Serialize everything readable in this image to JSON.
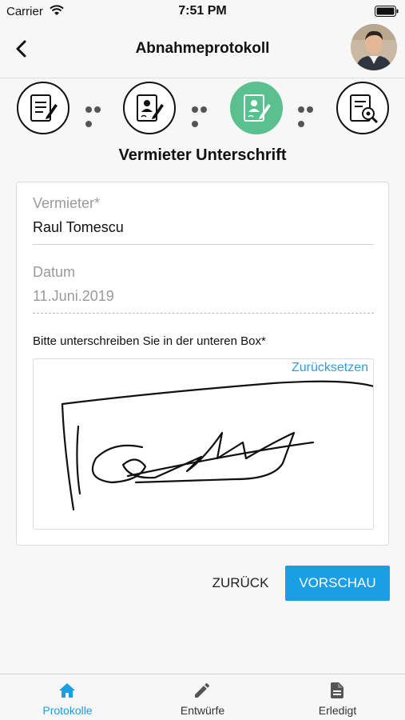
{
  "status_bar": {
    "carrier": "Carrier",
    "time": "7:51 PM"
  },
  "header": {
    "title": "Abnahmeprotokoll"
  },
  "steps": [
    {
      "icon": "document-edit-icon",
      "active": false
    },
    {
      "icon": "tenant-sign-icon",
      "active": false
    },
    {
      "icon": "landlord-sign-icon",
      "active": true
    },
    {
      "icon": "document-preview-icon",
      "active": false
    }
  ],
  "section": {
    "title": "Vermieter Unterschrift"
  },
  "form": {
    "landlord_label": "Vermieter*",
    "landlord_value": "Raul Tomescu",
    "date_label": "Datum",
    "date_value": "11.Juni.2019",
    "signature_caption": "Bitte unterschreiben Sie in der unteren Box*",
    "reset_label": "Zurücksetzen"
  },
  "buttons": {
    "back_label": "ZURÜCK",
    "preview_label": "VORSCHAU"
  },
  "tabbar": {
    "items": [
      {
        "label": "Protokolle",
        "icon": "home-icon",
        "active": true
      },
      {
        "label": "Entwürfe",
        "icon": "pencil-icon",
        "active": false
      },
      {
        "label": "Erledigt",
        "icon": "document-icon",
        "active": false
      }
    ]
  },
  "colors": {
    "accent": "#1a9ee4",
    "active_step": "#5ac18e"
  }
}
